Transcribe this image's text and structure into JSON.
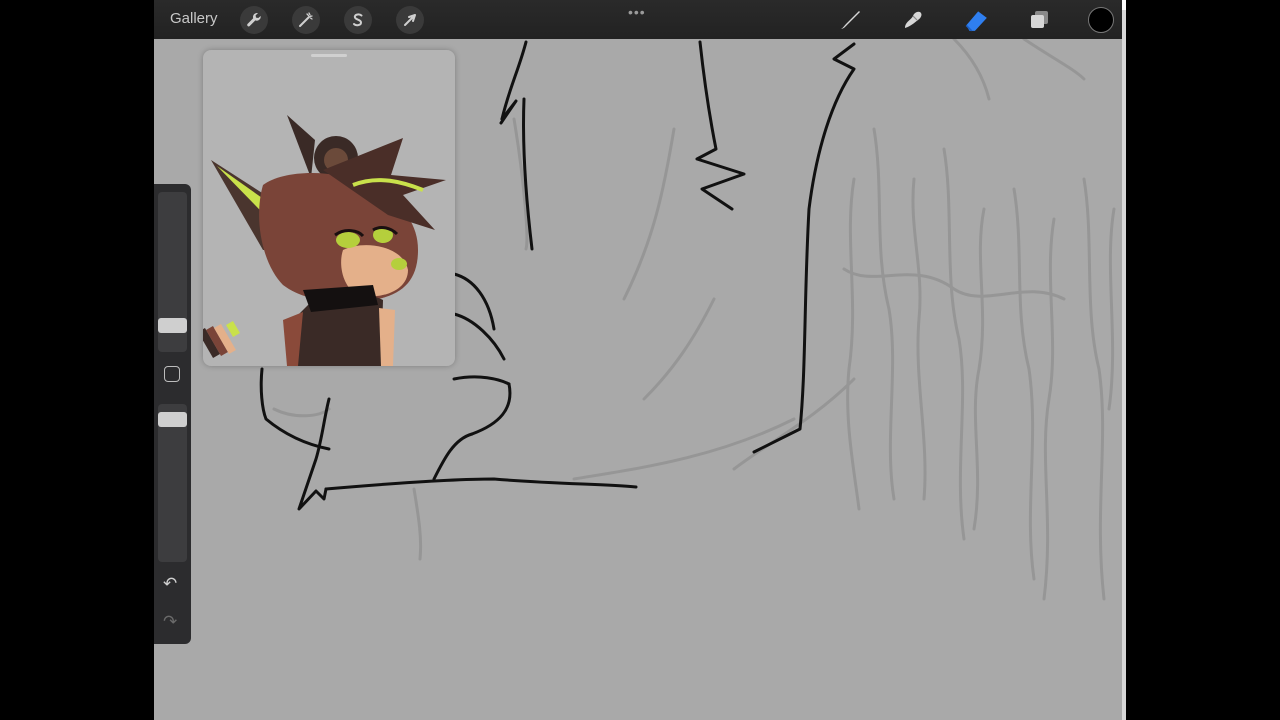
{
  "app": {
    "gallery_label": "Gallery",
    "menu_dots": "•••"
  },
  "toolbar_left": [
    {
      "name": "actions-wrench-icon"
    },
    {
      "name": "adjustments-wand-icon"
    },
    {
      "name": "selection-s-icon"
    },
    {
      "name": "transform-arrow-icon"
    }
  ],
  "toolbar_right": [
    {
      "name": "brush-icon",
      "active": false
    },
    {
      "name": "smudge-icon",
      "active": false
    },
    {
      "name": "eraser-icon",
      "active": true
    },
    {
      "name": "layers-icon",
      "active": false
    }
  ],
  "colors": {
    "canvas_bg": "#a9a9a9",
    "toolbar_bg": "#222222",
    "active_tool": "#2f7ff0",
    "current_color": "#000000"
  },
  "sidebar": {
    "undo_icon": "↶",
    "redo_icon": "↷",
    "brush_size": 0.72,
    "opacity": 0.3
  }
}
